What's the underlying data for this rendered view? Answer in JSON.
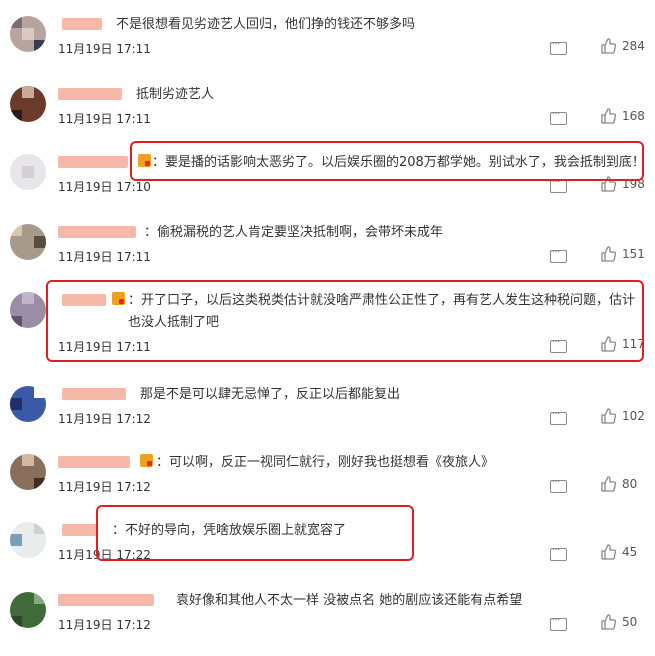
{
  "comments": [
    {
      "text": "不是很想看见劣迹艺人回归，他们挣的钱还不够多吗",
      "time": "11月19日 17:11",
      "likes": "284",
      "highlighted": false
    },
    {
      "text": "抵制劣迹艺人",
      "time": "11月19日 17:11",
      "likes": "168",
      "highlighted": false
    },
    {
      "text": "：要是播的话影响太恶劣了。以后娱乐圈的208万都学她。别试水了，我会抵制到底！",
      "time": "11月19日 17:10",
      "likes": "198",
      "highlighted": true
    },
    {
      "text": "：偷税漏税的艺人肯定要坚决抵制啊，会带坏未成年",
      "time": "11月19日 17:11",
      "likes": "151",
      "highlighted": false
    },
    {
      "text": "：开了口子，以后这类税类估计就没啥严肃性公正性了，再有艺人发生这种税问题，估计也没人抵制了吧",
      "time": "11月19日 17:11",
      "likes": "117",
      "highlighted": true
    },
    {
      "text": "那是不是可以肆无忌惮了，反正以后都能复出",
      "time": "11月19日 17:12",
      "likes": "102",
      "highlighted": false
    },
    {
      "text": "：可以啊，反正一视同仁就行，刚好我也挺想看《夜旅人》",
      "time": "11月19日 17:12",
      "likes": "80",
      "highlighted": false
    },
    {
      "text": "：不好的导向，凭啥放娱乐圈上就宽容了",
      "time": "11月19日 17:22",
      "likes": "45",
      "highlighted": true
    },
    {
      "text": "袁好像和其他人不太一样 没被点名 她的剧应该还能有点希望",
      "time": "11月19日 17:12",
      "likes": "50",
      "highlighted": false
    }
  ],
  "icons": {
    "comment": "comment-bubble-icon",
    "like": "thumbs-up-icon"
  },
  "colors": {
    "highlight": "#e02020",
    "name_blur": "#f6b8a8"
  }
}
